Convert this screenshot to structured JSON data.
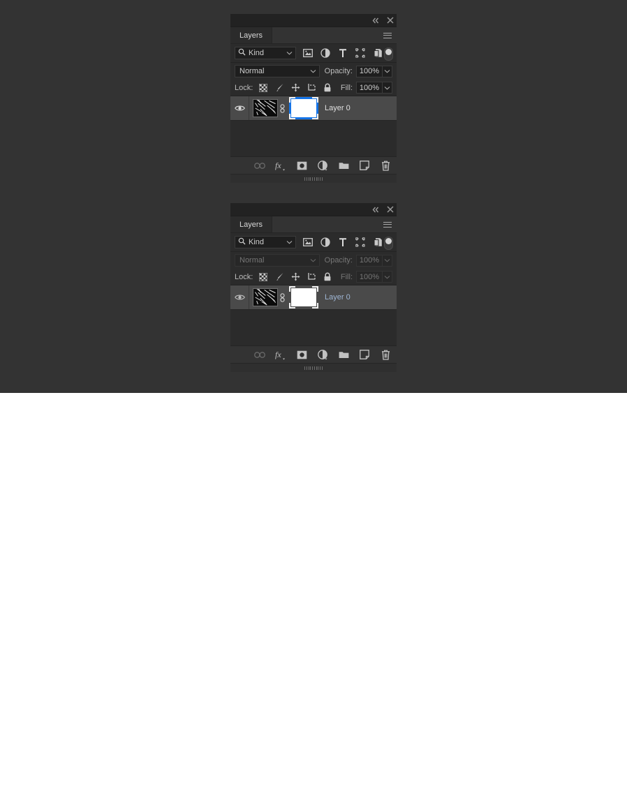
{
  "app": {
    "background_color": "#333333",
    "panel_background": "#2b2b2b",
    "accent_color": "#1473e6",
    "selected_row_color": "#4a4a4a"
  },
  "panels": [
    {
      "id": "layers-panel-top",
      "tab_label": "Layers",
      "titlebar": {
        "collapse_icon": "double-arrow-left-icon",
        "close_icon": "close-icon"
      },
      "menu_icon": "panel-menu-icon",
      "filter": {
        "search_icon": "search-icon",
        "kind_label": "Kind",
        "chevron_icon": "chevron-down-icon",
        "icons": [
          "filter-pixel-layers-icon",
          "filter-adjustment-layers-icon",
          "filter-type-layers-icon",
          "filter-shape-layers-icon",
          "filter-smart-object-icon"
        ],
        "toggle_icon": "filter-enable-toggle"
      },
      "blend": {
        "mode": "Normal",
        "opacity_label": "Opacity:",
        "opacity_value": "100%",
        "disabled": false
      },
      "lock": {
        "label": "Lock:",
        "icons": [
          "lock-transparent-pixels-icon",
          "lock-image-pixels-icon",
          "lock-position-icon",
          "lock-artboard-nesting-icon",
          "lock-all-icon"
        ],
        "fill_label": "Fill:",
        "fill_value": "100%",
        "disabled": false
      },
      "layers": [
        {
          "visible": true,
          "eye_icon": "eye-visibility-icon",
          "link_icon": "link-mask-icon",
          "name": "Layer 0",
          "thumbnail": "dark-scratch-texture",
          "mask": "white-mask",
          "mask_selected": true,
          "mask_selection_style": "blue-border",
          "name_color": "#e0e0e0"
        }
      ],
      "bottom_toolbar": [
        {
          "icon": "link-layers-icon",
          "disabled": true
        },
        {
          "icon": "layer-style-fx-icon",
          "disabled": false
        },
        {
          "icon": "add-layer-mask-icon",
          "disabled": false
        },
        {
          "icon": "new-adjustment-layer-icon",
          "disabled": false
        },
        {
          "icon": "new-group-folder-icon",
          "disabled": false
        },
        {
          "icon": "new-layer-icon",
          "disabled": false
        },
        {
          "icon": "delete-layer-trash-icon",
          "disabled": false
        }
      ],
      "resize_grip": "panel-resize-grip"
    },
    {
      "id": "layers-panel-bottom",
      "tab_label": "Layers",
      "titlebar": {
        "collapse_icon": "double-arrow-left-icon",
        "close_icon": "close-icon"
      },
      "menu_icon": "panel-menu-icon",
      "filter": {
        "search_icon": "search-icon",
        "kind_label": "Kind",
        "chevron_icon": "chevron-down-icon",
        "icons": [
          "filter-pixel-layers-icon",
          "filter-adjustment-layers-icon",
          "filter-type-layers-icon",
          "filter-shape-layers-icon",
          "filter-smart-object-icon"
        ],
        "toggle_icon": "filter-enable-toggle"
      },
      "blend": {
        "mode": "Normal",
        "opacity_label": "Opacity:",
        "opacity_value": "100%",
        "disabled": true
      },
      "lock": {
        "label": "Lock:",
        "icons": [
          "lock-transparent-pixels-icon",
          "lock-image-pixels-icon",
          "lock-position-icon",
          "lock-artboard-nesting-icon",
          "lock-all-icon"
        ],
        "fill_label": "Fill:",
        "fill_value": "100%",
        "disabled": true
      },
      "layers": [
        {
          "visible": true,
          "eye_icon": "eye-visibility-icon",
          "link_icon": "link-mask-icon",
          "name": "Layer 0",
          "thumbnail": "dark-scratch-texture",
          "mask": "white-mask",
          "mask_selected": false,
          "mask_selection_style": "corner-brackets",
          "name_color": "#9fb6d4"
        }
      ],
      "bottom_toolbar": [
        {
          "icon": "link-layers-icon",
          "disabled": true
        },
        {
          "icon": "layer-style-fx-icon",
          "disabled": false
        },
        {
          "icon": "add-layer-mask-icon",
          "disabled": false
        },
        {
          "icon": "new-adjustment-layer-icon",
          "disabled": false
        },
        {
          "icon": "new-group-folder-icon",
          "disabled": false
        },
        {
          "icon": "new-layer-icon",
          "disabled": false
        },
        {
          "icon": "delete-layer-trash-icon",
          "disabled": false
        }
      ],
      "resize_grip": "panel-resize-grip"
    }
  ]
}
